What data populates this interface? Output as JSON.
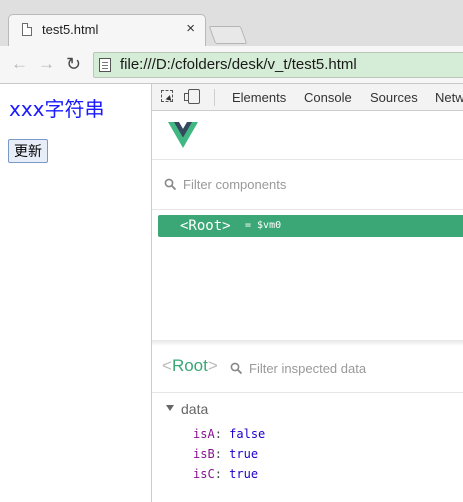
{
  "browser": {
    "tab_title": "test5.html",
    "tab_close": "×",
    "url": "file:///D:/cfolders/desk/v_t/test5.html"
  },
  "page": {
    "text": "xxx字符串",
    "button_label": "更新"
  },
  "devtools": {
    "tabs": [
      "Elements",
      "Console",
      "Sources",
      "Network"
    ]
  },
  "vue": {
    "filter_placeholder": "Filter components",
    "root_component": "<Root>",
    "root_vm": "= $vm0",
    "inspect_root": "Root",
    "inspect_filter_placeholder": "Filter inspected data",
    "data_label": "data",
    "props": [
      {
        "key": "isA",
        "value": "false"
      },
      {
        "key": "isB",
        "value": "true"
      },
      {
        "key": "isC",
        "value": "true"
      }
    ]
  },
  "colors": {
    "vue_green": "#3ba776",
    "page_text_blue": "#1a1aff",
    "omnibox_secure_green": "#d5ecd6"
  }
}
